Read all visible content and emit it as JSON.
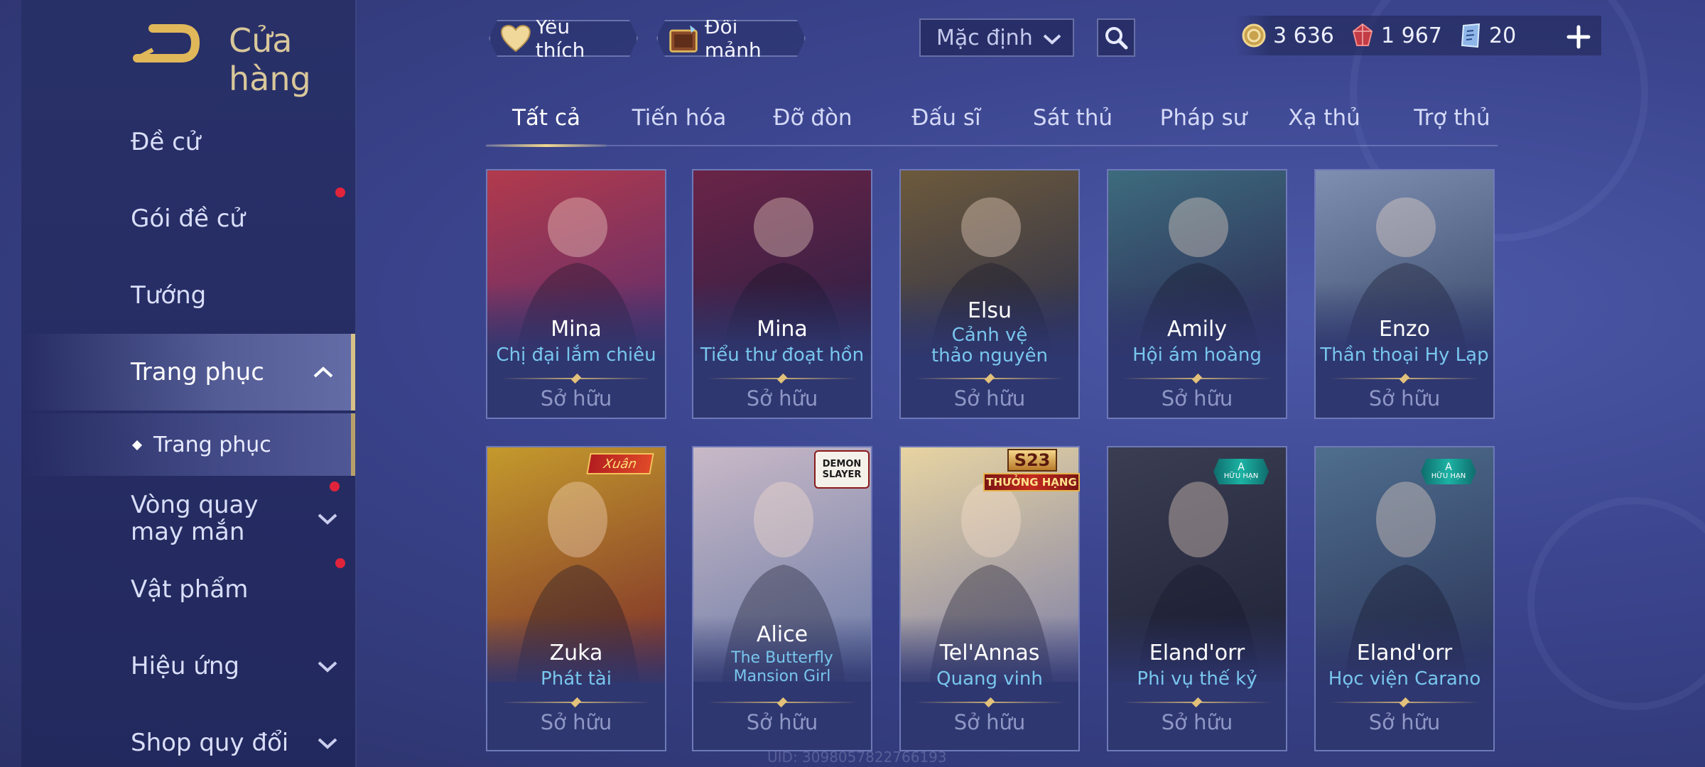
{
  "header": {
    "title": "Cửa hàng",
    "favorites_label": "Yêu thích",
    "exchange_label": "Đổi mảnh",
    "sort_value": "Mặc định"
  },
  "currency": {
    "gold": "3 636",
    "ruby": "1 967",
    "voucher": "20"
  },
  "sidebar": {
    "items": [
      {
        "label": "Đề cử"
      },
      {
        "label": "Gói đề cử"
      },
      {
        "label": "Tướng"
      },
      {
        "label": "Trang phục"
      },
      {
        "label": "Vòng quay may mắn"
      },
      {
        "label": "Vật phẩm"
      },
      {
        "label": "Hiệu ứng"
      },
      {
        "label": "Shop quy đổi"
      }
    ],
    "sub_item": "Trang phục"
  },
  "tabs": [
    "Tất cả",
    "Tiến hóa",
    "Đỡ đòn",
    "Đấu sĩ",
    "Sát thủ",
    "Pháp sư",
    "Xạ thủ",
    "Trợ thủ"
  ],
  "cards": [
    {
      "hero": "Mina",
      "skin": "Chị đại lắm chiêu",
      "status": "Sở hữu",
      "art": [
        "#b23a4c",
        "#5b2d6e"
      ]
    },
    {
      "hero": "Mina",
      "skin": "Tiểu thư đoạt hồn",
      "status": "Sở hữu",
      "art": [
        "#6a2447",
        "#2a1f45"
      ]
    },
    {
      "hero": "Elsu",
      "skin": "Cảnh vệ thảo nguyên",
      "status": "Sở hữu",
      "art": [
        "#6d5a3c",
        "#2b2f4a"
      ]
    },
    {
      "hero": "Amily",
      "skin": "Hội ám hoàng",
      "status": "Sở hữu",
      "art": [
        "#3d6b7e",
        "#2c2852"
      ]
    },
    {
      "hero": "Enzo",
      "skin": "Thần thoại Hy Lạp",
      "status": "Sở hữu",
      "art": [
        "#7e8fb2",
        "#3a4a6a"
      ]
    },
    {
      "hero": "Zuka",
      "skin": "Phát tài",
      "status": "Sở hữu",
      "art": [
        "#c49a2c",
        "#7a2a2a"
      ]
    },
    {
      "hero": "Alice",
      "skin": "The Butterfly Mansion Girl",
      "status": "Sở hữu",
      "art": [
        "#c9b9c7",
        "#6a7aa6"
      ]
    },
    {
      "hero": "Tel'Annas",
      "skin": "Quang vinh",
      "status": "Sở hữu",
      "art": [
        "#e7d4a2",
        "#7d7ea8"
      ]
    },
    {
      "hero": "Eland'orr",
      "skin": "Phi vụ thế kỷ",
      "status": "Sở hữu",
      "art": [
        "#3b3e52",
        "#1f2238"
      ]
    },
    {
      "hero": "Eland'orr",
      "skin": "Học viện Carano",
      "status": "Sở hữu",
      "art": [
        "#4f6e8e",
        "#2a3358"
      ]
    }
  ],
  "badges": {
    "zuka": "Xuân",
    "alice": "DEMON SLAYER",
    "telannas_season": "S23",
    "telannas_rank": "THƯỞNG HẠNG",
    "limited_grade": "A",
    "limited_text": "HỮU HẠN"
  },
  "uid": "UID: 3098057822766193",
  "colors": {
    "accent_gold": "#d8c79a",
    "skin_name": "#78c6ee",
    "notification": "#e1243b"
  }
}
